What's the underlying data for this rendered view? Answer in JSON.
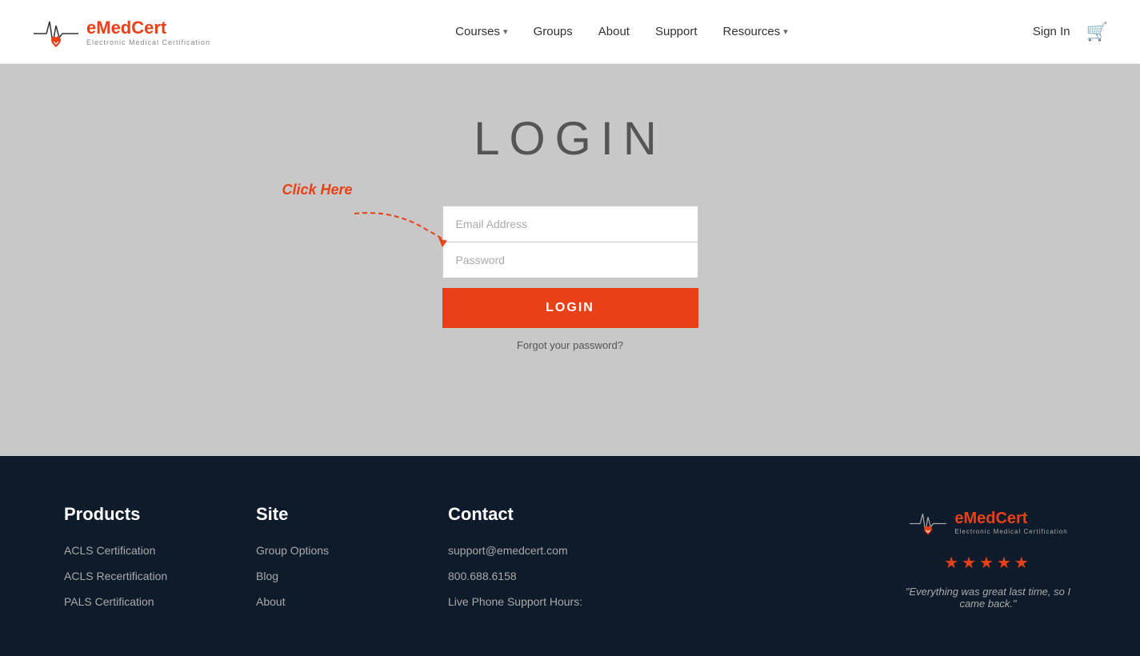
{
  "header": {
    "logo_name_prefix": "e",
    "logo_name_suffix": "MedCert",
    "logo_sub": "Electronic Medical Certification",
    "nav": [
      {
        "label": "Courses",
        "has_dropdown": true
      },
      {
        "label": "Groups",
        "has_dropdown": false
      },
      {
        "label": "About",
        "has_dropdown": false
      },
      {
        "label": "Support",
        "has_dropdown": false
      },
      {
        "label": "Resources",
        "has_dropdown": true
      }
    ],
    "sign_in": "Sign In"
  },
  "main": {
    "page_title": "LOGIN",
    "form": {
      "email_placeholder": "Email Address",
      "password_placeholder": "Password",
      "login_button": "LOGIN",
      "forgot_link": "Forgot your password?",
      "annotation_text": "Click Here"
    }
  },
  "footer": {
    "products": {
      "title": "Products",
      "links": [
        "ACLS Certification",
        "ACLS Recertification",
        "PALS Certification"
      ]
    },
    "site": {
      "title": "Site",
      "links": [
        "Group Options",
        "Blog",
        "About"
      ]
    },
    "contact": {
      "title": "Contact",
      "email": "support@emedcert.com",
      "phone": "800.688.6158",
      "hours_label": "Live Phone Support Hours:"
    },
    "brand": {
      "logo_prefix": "e",
      "logo_suffix": "MedCert",
      "logo_sub": "Electronic Medical Certification",
      "stars": "★★★★★",
      "testimonial": "\"Everything was great last time, so I came back.\""
    }
  }
}
